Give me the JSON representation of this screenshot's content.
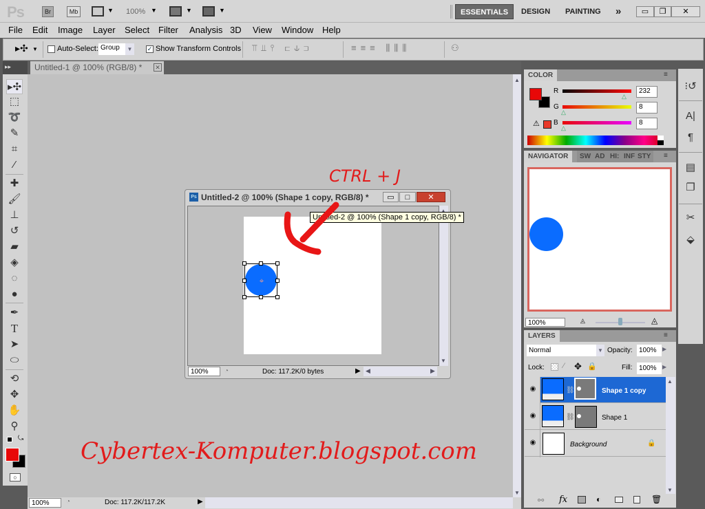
{
  "app": {
    "logo": "Ps",
    "bridge": "Br",
    "minibridge": "Mb",
    "zoom": "100%"
  },
  "workspaces": [
    {
      "label": "ESSENTIALS",
      "active": true
    },
    {
      "label": "DESIGN"
    },
    {
      "label": "PAINTING"
    },
    {
      "label": "»"
    }
  ],
  "window_controls": {
    "minimize": "▭",
    "restore": "❐",
    "close": "✕"
  },
  "menu": [
    "File",
    "Edit",
    "Image",
    "Layer",
    "Select",
    "Filter",
    "Analysis",
    "3D",
    "View",
    "Window",
    "Help"
  ],
  "options": {
    "auto_select_label": "Auto-Select:",
    "auto_select_checked": false,
    "auto_select_value": "Group",
    "show_transform_label": "Show Transform Controls",
    "show_transform_checked": true
  },
  "doc_tab": {
    "title": "Untitled-1 @ 100% (RGB/8) *",
    "close": "✕"
  },
  "float_window": {
    "icon": "Ps",
    "title": "Untitled-2 @ 100% (Shape 1 copy, RGB/8) *",
    "tooltip": "Untitled-2 @ 100% (Shape 1 copy, RGB/8) *",
    "zoom": "100%",
    "doc_info": "Doc: 117.2K/0 bytes"
  },
  "annotations": {
    "shortcut": "CTRL + J",
    "watermark": "Cybertex-Komputer.blogspot.com"
  },
  "main_status": {
    "zoom": "100%",
    "doc_info": "Doc: 117.2K/117.2K"
  },
  "tools": [
    "move",
    "marquee",
    "lasso",
    "quick-selection",
    "crop",
    "eyedropper",
    "spot-healing",
    "brush",
    "clone-stamp",
    "history-brush",
    "eraser",
    "paint-bucket",
    "dodge",
    "burn",
    "pen",
    "type",
    "path-selection",
    "ellipse",
    "3d-rotate",
    "3d-orbit",
    "hand",
    "zoom"
  ],
  "colors": {
    "foreground": "#e80808",
    "background": "#000000",
    "shape": "#0a6cff",
    "accent_selection": "#1d68d4"
  },
  "color_panel": {
    "tab": "COLOR",
    "r_label": "R",
    "g_label": "G",
    "b_label": "B",
    "r": "232",
    "g": "8",
    "b": "8",
    "r_pct": 0.91,
    "g_pct": 0.03,
    "b_pct": 0.03
  },
  "navigator": {
    "tabs": [
      "NAVIGATOR",
      "SW",
      "AD",
      "HI:",
      "INF",
      "STY"
    ],
    "zoom": "100%",
    "slider_pct": 0.5
  },
  "layers": {
    "tab": "LAYERS",
    "blend_mode": "Normal",
    "opacity_label": "Opacity:",
    "opacity": "100%",
    "lock_label": "Lock:",
    "fill_label": "Fill:",
    "fill": "100%",
    "items": [
      {
        "name": "Shape 1 copy",
        "selected": true,
        "type": "shape"
      },
      {
        "name": "Shape 1",
        "selected": false,
        "type": "shape"
      },
      {
        "name": "Background",
        "selected": false,
        "type": "background",
        "locked": true
      }
    ],
    "footer_icons": [
      "link-icon",
      "fx-icon",
      "mask-icon",
      "adjustment-icon",
      "group-icon",
      "new-layer-icon",
      "trash-icon"
    ]
  },
  "side_strip_icons": [
    "history-icon",
    "character-icon",
    "paragraph-icon",
    "notes-icon",
    "clone-source-icon",
    "tools-preset-icon",
    "3d-icon"
  ]
}
